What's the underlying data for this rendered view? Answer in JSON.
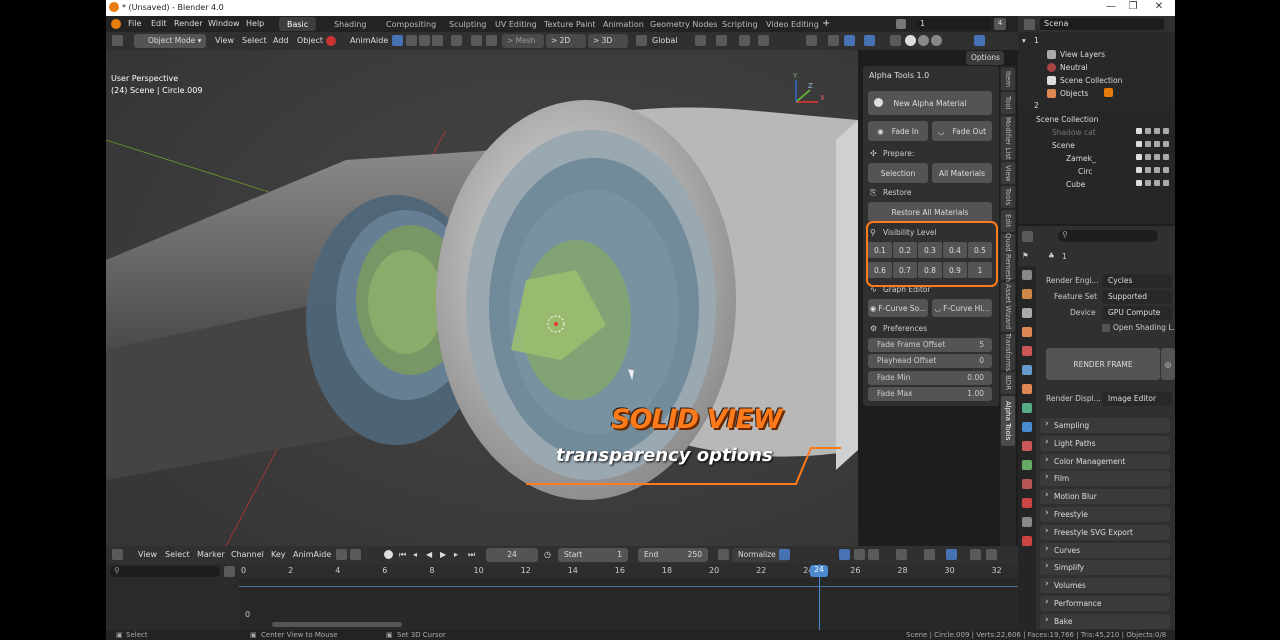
{
  "window": {
    "title": "* (Unsaved) - Blender 4.0",
    "min": "—",
    "max": "❐",
    "close": "✕"
  },
  "menu": [
    "File",
    "Edit",
    "Render",
    "Window",
    "Help"
  ],
  "workspaces": [
    "Basic",
    "Shading",
    "Compositing",
    "Sculpting",
    "UV Editing",
    "Texture Paint",
    "Animation",
    "Geometry Nodes",
    "Scripting",
    "Video Editing"
  ],
  "workspace_add": "+",
  "scene_field": {
    "value": "1",
    "count": "4"
  },
  "scene_name": "Scena",
  "viewport_header": {
    "mode": "Object Mode",
    "view": "View",
    "select": "Select",
    "add": "Add",
    "object": "Object",
    "animaide": "AnimAide",
    "mesh": "> Mesh",
    "to2d": "> 2D",
    "to3d": "> 3D",
    "orientation": "Global",
    "options": "Options"
  },
  "viewport_overlay": {
    "perspective": "User Perspective",
    "object": "(24) Scene | Circle.009"
  },
  "gizmo": {
    "x": "X",
    "y": "Y",
    "z": "Z"
  },
  "alpha_tools": {
    "title": "Alpha Tools 1.0",
    "new_material": "New Alpha Material",
    "fade_in": "Fade In",
    "fade_out": "Fade Out",
    "prepare": "Prepare:",
    "selection": "Selection",
    "all_materials": "All Materials",
    "restore": "Restore",
    "restore_all": "Restore All Materials",
    "visibility_level": "Visibility Level",
    "levels": [
      "0.1",
      "0.2",
      "0.3",
      "0.4",
      "0.5",
      "0.6",
      "0.7",
      "0.8",
      "0.9",
      "1"
    ],
    "graph_editor": "Graph Editor",
    "fcurve_so": "F-Curve So...",
    "fcurve_hi": "F-Curve Hi...",
    "preferences": "Preferences",
    "fields": [
      {
        "label": "Fade Frame Offset",
        "value": "5"
      },
      {
        "label": "Playhead Offset",
        "value": "0"
      },
      {
        "label": "Fade Min",
        "value": "0.00"
      },
      {
        "label": "Fade Max",
        "value": "1.00"
      }
    ]
  },
  "side_tabs": [
    "Item",
    "Tool",
    "Modifier List",
    "View",
    "Tools",
    "Edit",
    "Quad Remesh",
    "Asset Wizard",
    "Transforms",
    "BDR",
    "Alpha Tools"
  ],
  "callout": {
    "headline": "SOLID VIEW",
    "subline": "transparency options"
  },
  "outliner": {
    "root": "1",
    "items": [
      "View Layers",
      "Neutral",
      "Scene Collection",
      "Objects",
      "2"
    ],
    "collection": "Scene Collection",
    "rows": [
      "Shadow cat",
      "Scene",
      "Zamek_",
      "Circ",
      "Cube"
    ]
  },
  "properties": {
    "search_placeholder": "",
    "scene_label": "1",
    "render_engine_label": "Render Engi...",
    "render_engine": "Cycles",
    "feature_set_label": "Feature Set",
    "feature_set": "Supported",
    "device_label": "Device",
    "device": "GPU Compute",
    "open_shading": "Open Shading L...",
    "render_frame": "RENDER FRAME",
    "render_display_label": "Render Displ...",
    "render_display": "Image Editor",
    "sections": [
      "Sampling",
      "Light Paths",
      "Color Management",
      "Film",
      "Motion Blur",
      "Freestyle",
      "Freestyle SVG Export",
      "Curves",
      "Simplify",
      "Volumes",
      "Performance",
      "Bake"
    ]
  },
  "timeline": {
    "view": "View",
    "select": "Select",
    "marker": "Marker",
    "channel": "Channel",
    "key": "Key",
    "animaide": "AnimAide",
    "current": "24",
    "start_label": "Start",
    "start": "1",
    "end_label": "End",
    "end": "250",
    "normalize": "Normalize",
    "ruler": [
      "0",
      "2",
      "4",
      "6",
      "8",
      "10",
      "12",
      "14",
      "16",
      "18",
      "20",
      "22",
      "24",
      "26",
      "28",
      "30",
      "32"
    ],
    "playhead": "24",
    "row_value": "0"
  },
  "status": {
    "select": "Select",
    "center": "Center View to Mouse",
    "cursor": "Set 3D Cursor",
    "stats": "Scene | Circle.009 | Verts:22,606 | Faces:19,766 | Tris:45,210 | Objects:0/8"
  }
}
